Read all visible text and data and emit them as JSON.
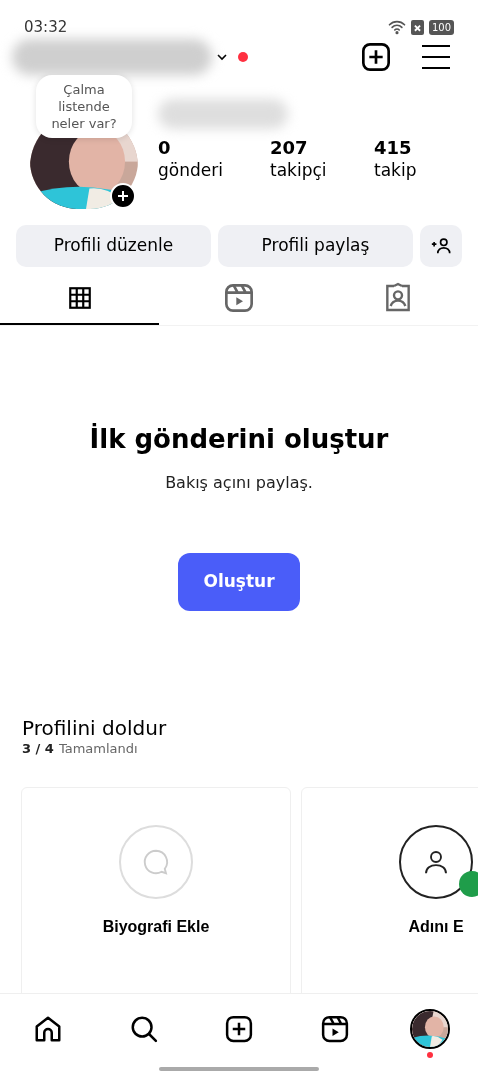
{
  "status_bar": {
    "time": "03:32",
    "battery": "100"
  },
  "header": {
    "notification_dot": true
  },
  "profile": {
    "note": "Çalma listende neler var?",
    "stats": [
      {
        "value": "0",
        "label": "gönderi"
      },
      {
        "value": "207",
        "label": "takipçi"
      },
      {
        "value": "415",
        "label": "takip"
      }
    ]
  },
  "actions": [
    "Profili düzenle",
    "Profili paylaş"
  ],
  "tabs": [
    {
      "kind": "grid",
      "selected": true
    },
    {
      "kind": "reels",
      "selected": false
    },
    {
      "kind": "tagged",
      "selected": false
    }
  ],
  "empty_state": {
    "title": "İlk gönderini oluştur",
    "subtitle": "Bakış açını paylaş.",
    "button": "Oluştur"
  },
  "complete_profile": {
    "title": "Profilini doldur",
    "count": "3 / 4",
    "count_label": "Tamamlandı",
    "cards": [
      {
        "kind": "bio",
        "title": "Biyografi Ekle",
        "done": false
      },
      {
        "kind": "name",
        "title": "Adını E",
        "done": true
      }
    ]
  },
  "bottom_nav": [
    {
      "kind": "home"
    },
    {
      "kind": "search"
    },
    {
      "kind": "create"
    },
    {
      "kind": "reels"
    },
    {
      "kind": "profile",
      "notification_dot": true
    }
  ]
}
